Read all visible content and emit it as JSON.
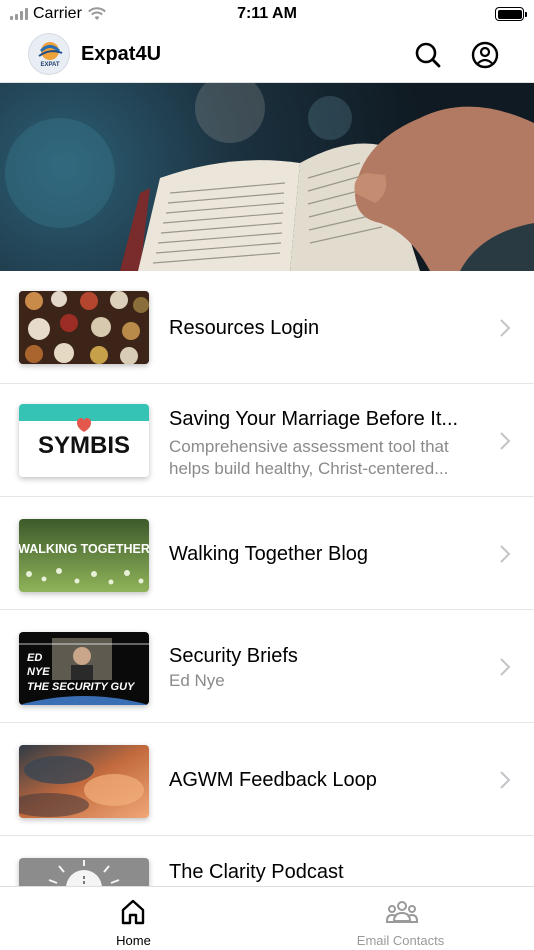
{
  "status_bar": {
    "carrier": "Carrier",
    "time": "7:11 AM"
  },
  "header": {
    "title": "Expat4U",
    "logo_text": "EXPAT"
  },
  "items": [
    {
      "title": "Resources Login",
      "subtitle": ""
    },
    {
      "title": "Saving Your Marriage Before It...",
      "subtitle": "Comprehensive assessment tool that helps build healthy, Christ-centered...",
      "thumb_text": "SYMBIS"
    },
    {
      "title": "Walking Together Blog",
      "subtitle": "",
      "thumb_text": "WALKING TOGETHER"
    },
    {
      "title": "Security Briefs",
      "subtitle": "Ed Nye",
      "thumb_text_1": "ED",
      "thumb_text_2": "NYE",
      "thumb_text_3": "THE SECURITY GUY"
    },
    {
      "title": "AGWM Feedback Loop",
      "subtitle": ""
    },
    {
      "title": "The Clarity Podcast",
      "subtitle": ""
    }
  ],
  "tabs": [
    {
      "label": "Home",
      "color": "#000000"
    },
    {
      "label": "Email Contacts",
      "color": "#9a9a9a"
    }
  ]
}
